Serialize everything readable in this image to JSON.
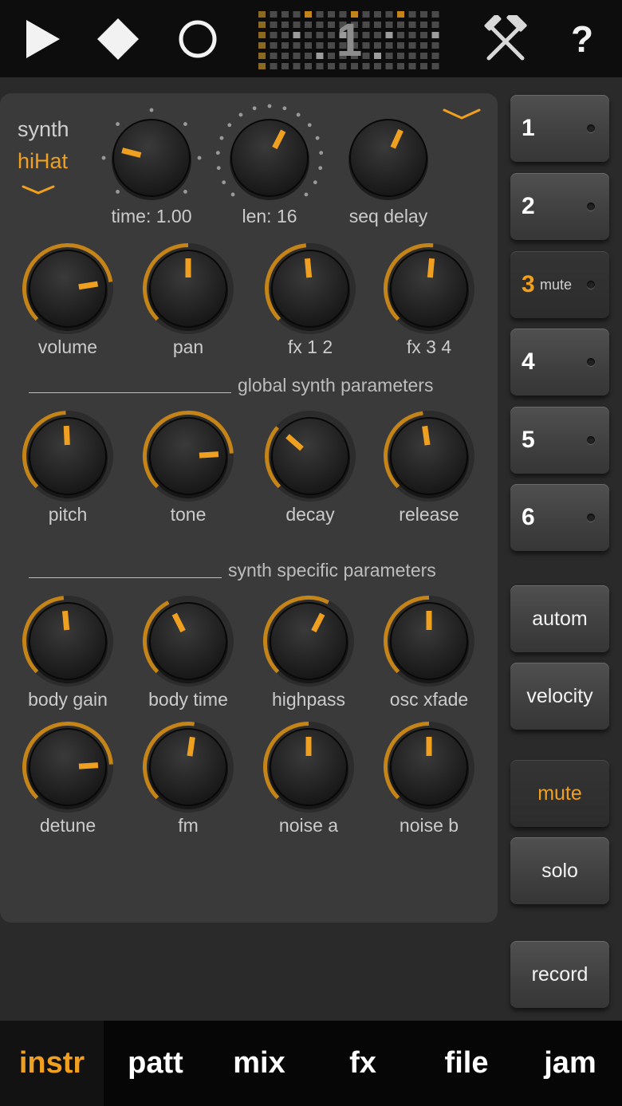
{
  "transport": {
    "play_icon": "play-icon",
    "stop_icon": "stop-icon",
    "record_icon": "record-circle-icon",
    "pattern_display_value": "1",
    "tools_icon": "tools-icon",
    "help_label": "?"
  },
  "synth_header": {
    "synth_label": "synth",
    "instrument_name": "hiHat",
    "time_label": "time: 1.00",
    "len_label": "len: 16",
    "seq_delay_label": "seq delay"
  },
  "knobs_mix": [
    {
      "label": "volume",
      "value": 0.8
    },
    {
      "label": "pan",
      "value": 0.5
    },
    {
      "label": "fx 1 2",
      "value": 0.48
    },
    {
      "label": "fx 3 4",
      "value": 0.52
    }
  ],
  "section_global": "global synth parameters",
  "knobs_global": [
    {
      "label": "pitch",
      "value": 0.49
    },
    {
      "label": "tone",
      "value": 0.82
    },
    {
      "label": "decay",
      "value": 0.32
    },
    {
      "label": "release",
      "value": 0.47
    }
  ],
  "section_specific": "synth specific parameters",
  "knobs_specific_1": [
    {
      "label": "body gain",
      "value": 0.48
    },
    {
      "label": "body time",
      "value": 0.4
    },
    {
      "label": "highpass",
      "value": 0.6
    },
    {
      "label": "osc xfade",
      "value": 0.5
    }
  ],
  "knobs_specific_2": [
    {
      "label": "detune",
      "value": 0.82
    },
    {
      "label": "fm",
      "value": 0.53
    },
    {
      "label": "noise a",
      "value": 0.5
    },
    {
      "label": "noise b",
      "value": 0.5
    }
  ],
  "tracks": [
    {
      "number": "1",
      "mute_label": ""
    },
    {
      "number": "2",
      "mute_label": ""
    },
    {
      "number": "3",
      "mute_label": "mute"
    },
    {
      "number": "4",
      "mute_label": ""
    },
    {
      "number": "5",
      "mute_label": ""
    },
    {
      "number": "6",
      "mute_label": ""
    }
  ],
  "side_buttons": {
    "autom": "autom",
    "velocity": "velocity",
    "mute": "mute",
    "solo": "solo",
    "record": "record"
  },
  "bottom_tabs": [
    "instr",
    "patt",
    "mix",
    "fx",
    "file",
    "jam"
  ],
  "active_tab": "instr",
  "colors": {
    "accent": "#f0a020",
    "panel": "#3a3a3a",
    "background": "#2a2a2a",
    "bar": "#0d0d0d"
  }
}
